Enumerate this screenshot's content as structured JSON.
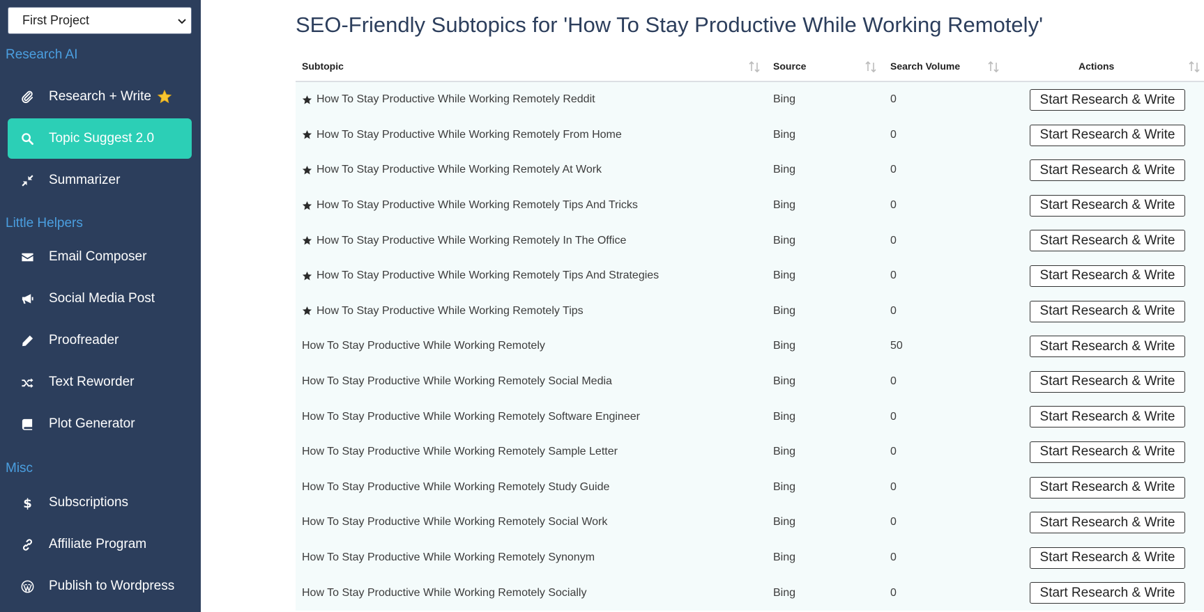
{
  "sidebar": {
    "project_select": "First Project",
    "sections": [
      {
        "label": "Research AI",
        "items": [
          {
            "label": "Research + Write",
            "icon": "paperclip-icon",
            "starred": true
          },
          {
            "label": "Topic Suggest 2.0",
            "icon": "search-icon",
            "active": true
          },
          {
            "label": "Summarizer",
            "icon": "compress-icon"
          }
        ]
      },
      {
        "label": "Little Helpers",
        "items": [
          {
            "label": "Email Composer",
            "icon": "envelope-icon"
          },
          {
            "label": "Social Media Post",
            "icon": "megaphone-icon"
          },
          {
            "label": "Proofreader",
            "icon": "pencil-icon"
          },
          {
            "label": "Text Reworder",
            "icon": "shuffle-icon"
          },
          {
            "label": "Plot Generator",
            "icon": "book-icon"
          }
        ]
      },
      {
        "label": "Misc",
        "items": [
          {
            "label": "Subscriptions",
            "icon": "dollar-icon"
          },
          {
            "label": "Affiliate Program",
            "icon": "link-icon"
          },
          {
            "label": "Publish to Wordpress",
            "icon": "wordpress-icon"
          }
        ]
      }
    ]
  },
  "main": {
    "title": "SEO-Friendly Subtopics for 'How To Stay Productive While Working Remotely'",
    "table": {
      "headers": {
        "subtopic": "Subtopic",
        "source": "Source",
        "volume": "Search Volume",
        "actions": "Actions"
      },
      "action_label": "Start Research & Write",
      "rows": [
        {
          "subtopic": "How To Stay Productive While Working Remotely Reddit",
          "source": "Bing",
          "volume": "0",
          "starred": true
        },
        {
          "subtopic": "How To Stay Productive While Working Remotely From Home",
          "source": "Bing",
          "volume": "0",
          "starred": true
        },
        {
          "subtopic": "How To Stay Productive While Working Remotely At Work",
          "source": "Bing",
          "volume": "0",
          "starred": true
        },
        {
          "subtopic": "How To Stay Productive While Working Remotely Tips And Tricks",
          "source": "Bing",
          "volume": "0",
          "starred": true
        },
        {
          "subtopic": "How To Stay Productive While Working Remotely In The Office",
          "source": "Bing",
          "volume": "0",
          "starred": true
        },
        {
          "subtopic": "How To Stay Productive While Working Remotely Tips And Strategies",
          "source": "Bing",
          "volume": "0",
          "starred": true
        },
        {
          "subtopic": "How To Stay Productive While Working Remotely Tips",
          "source": "Bing",
          "volume": "0",
          "starred": true
        },
        {
          "subtopic": "How To Stay Productive While Working Remotely",
          "source": "Bing",
          "volume": "50",
          "starred": false
        },
        {
          "subtopic": "How To Stay Productive While Working Remotely Social Media",
          "source": "Bing",
          "volume": "0",
          "starred": false
        },
        {
          "subtopic": "How To Stay Productive While Working Remotely Software Engineer",
          "source": "Bing",
          "volume": "0",
          "starred": false
        },
        {
          "subtopic": "How To Stay Productive While Working Remotely Sample Letter",
          "source": "Bing",
          "volume": "0",
          "starred": false
        },
        {
          "subtopic": "How To Stay Productive While Working Remotely Study Guide",
          "source": "Bing",
          "volume": "0",
          "starred": false
        },
        {
          "subtopic": "How To Stay Productive While Working Remotely Social Work",
          "source": "Bing",
          "volume": "0",
          "starred": false
        },
        {
          "subtopic": "How To Stay Productive While Working Remotely Synonym",
          "source": "Bing",
          "volume": "0",
          "starred": false
        },
        {
          "subtopic": "How To Stay Productive While Working Remotely Socially",
          "source": "Bing",
          "volume": "0",
          "starred": false
        }
      ]
    }
  },
  "colors": {
    "sidebar_bg": "#2c3e5c",
    "active_item": "#2ccfb6",
    "section_label": "#4b9fe0",
    "table_bg": "#f4fbfb"
  }
}
